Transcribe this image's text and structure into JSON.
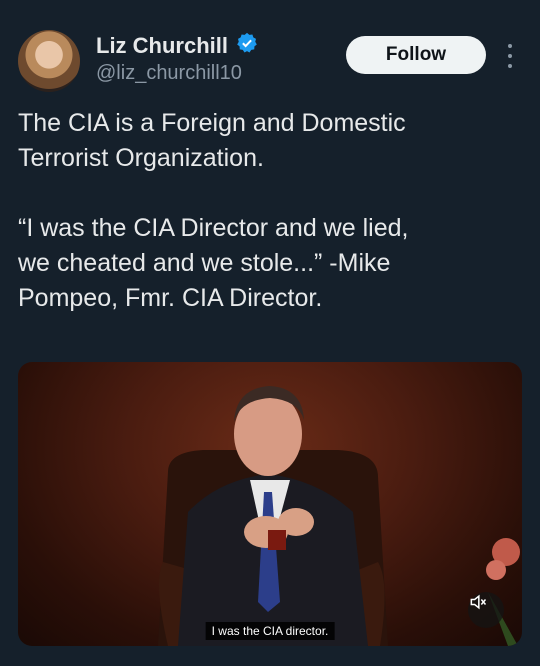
{
  "author": {
    "display_name": "Liz Churchill",
    "handle": "@liz_churchill10",
    "verified": true,
    "avatar_icon": "profile-photo"
  },
  "actions": {
    "follow_label": "Follow",
    "more_icon": "more-vertical-icon"
  },
  "tweet": {
    "text": "The CIA is a Foreign and Domestic\nTerrorist Organization.\n\n“I was the CIA Director and we lied,\nwe cheated and we stole...” -Mike\nPompeo, Fmr. CIA Director."
  },
  "media": {
    "caption": "I was the CIA director.",
    "mute_icon": "volume-muted-icon"
  },
  "colors": {
    "background": "#15202b",
    "text": "#e7e9ea",
    "secondary_text": "#8b98a5",
    "verified": "#1d9bf0",
    "follow_bg": "#eff3f4"
  }
}
